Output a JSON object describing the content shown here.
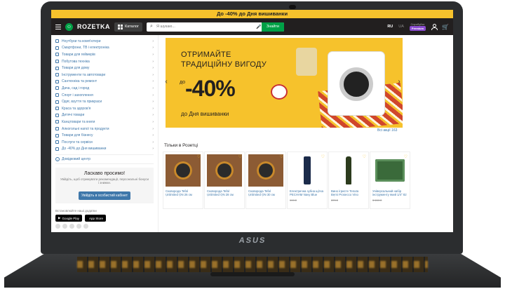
{
  "promo_bar": {
    "text": "До -40% до Дня вишиванки"
  },
  "header": {
    "logo": "ROZETKA",
    "catalog_label": "Каталог",
    "search_placeholder": "Я шукаю...",
    "search_button": "Знайти",
    "lang_active": "RU",
    "lang_other": "UA",
    "premium_top": "Спробуйте",
    "premium_badge": "Premium"
  },
  "sidebar": {
    "categories": [
      "Ноутбуки та комп'ютери",
      "Смартфони, ТВ і електроніка",
      "Товари для геймерів",
      "Побутова техніка",
      "Товари для дому",
      "Інструменти та автотовари",
      "Сантехніка та ремонт",
      "Дача, сад і город",
      "Спорт і захоплення",
      "Одяг, взуття та прикраси",
      "Краса та здоров'я",
      "Дитячі товари",
      "Канцтовари та книги",
      "Алкогольні напої та продукти",
      "Товари для бізнесу",
      "Послуги та сервіси",
      "До -40% до Дня вишиванки"
    ],
    "help": "Довідковий центр",
    "welcome_title": "Ласкаво просимо!",
    "welcome_text": "Увійдіть, щоб отримувати рекомендації, персональні бонуси і знижки.",
    "login_button": "Увійдіть в особистий кабінет",
    "apps_title": "Встановлюйте наші додатки",
    "google_play": "Google Play",
    "app_store": "App Store"
  },
  "banner": {
    "line1": "ОТРИМАЙТЕ",
    "line2": "ТРАДИЦІЙНУ ВИГОДУ",
    "do": "до",
    "percent": "-40%",
    "subtitle": "до Дня вишиванки",
    "all_promos": "Всі акції 163"
  },
  "section": {
    "title": "Тільки в Розетці"
  },
  "products": [
    {
      "name": "Сковорода Tefal Unlimited ON 26 см (G2560AZ)",
      "old_price": ""
    },
    {
      "name": "Сковорода Tefal Unlimited ON 28 см (G2560642)",
      "old_price": ""
    },
    {
      "name": "Сковорода Tefal Unlimited ON 30 см (G2590AZ)",
      "old_price": ""
    },
    {
      "name": "Електрична зубна щітка PECHAM Navy Blue",
      "old_price": "999 ₴"
    },
    {
      "name": "Вино ігристе Tenuta Berni Prosecco Vino Frizzante",
      "old_price": "379 ₴"
    },
    {
      "name": "Універсальний набір інструменту який 1/4\" 82",
      "old_price": "3 159 ₴"
    }
  ],
  "chin_logo": "ASUS"
}
